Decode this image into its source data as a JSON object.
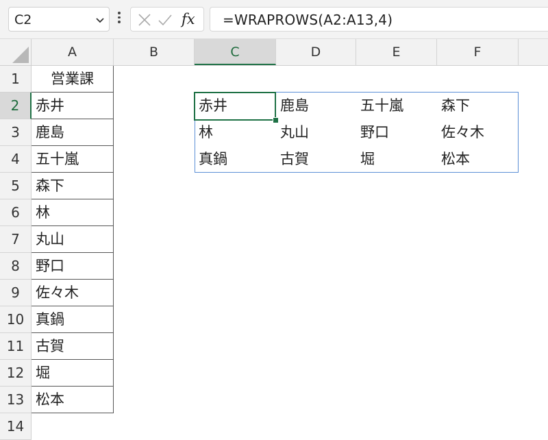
{
  "name_box": {
    "value": "C2",
    "icon": "chevron-down-icon"
  },
  "formula_bar": {
    "cancel_icon": "close-icon",
    "enter_icon": "checkmark-icon",
    "fx_label": "fx",
    "formula": "=WRAPROWS(A2:A13,4)"
  },
  "columns": [
    "A",
    "B",
    "C",
    "D",
    "E",
    "F"
  ],
  "selected_column": "C",
  "rows": [
    "1",
    "2",
    "3",
    "4",
    "5",
    "6",
    "7",
    "8",
    "9",
    "10",
    "11",
    "12",
    "13",
    "14"
  ],
  "selected_row": "2",
  "column_a": {
    "header": "営業課",
    "values": [
      "赤井",
      "鹿島",
      "五十嵐",
      "森下",
      "林",
      "丸山",
      "野口",
      "佐々木",
      "真鍋",
      "古賀",
      "堀",
      "松本"
    ]
  },
  "spill_result": [
    [
      "赤井",
      "鹿島",
      "五十嵐",
      "森下"
    ],
    [
      "林",
      "丸山",
      "野口",
      "佐々木"
    ],
    [
      "真鍋",
      "古賀",
      "堀",
      "松本"
    ]
  ],
  "colors": {
    "accent": "#1e7145",
    "spill_border": "#5b8fd6"
  }
}
